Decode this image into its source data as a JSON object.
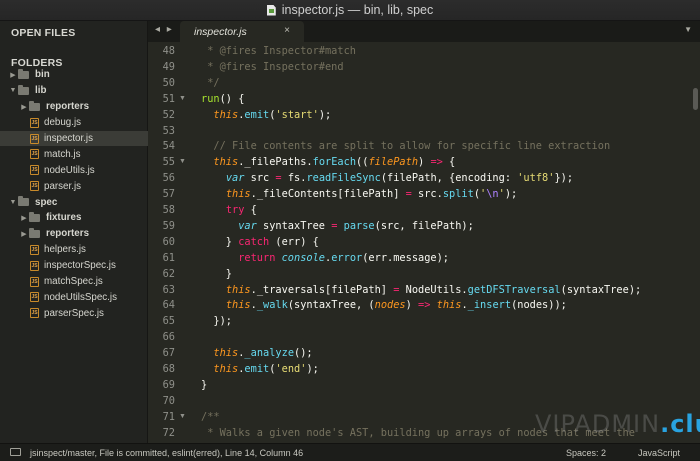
{
  "window": {
    "title": "inspector.js — bin, lib, spec"
  },
  "sidebar": {
    "open_files_heading": "OPEN FILES",
    "folders_heading": "FOLDERS",
    "tree": [
      {
        "label": "bin",
        "kind": "folder",
        "depth": 0,
        "expanded": false,
        "bold": true
      },
      {
        "label": "lib",
        "kind": "folder",
        "depth": 0,
        "expanded": true,
        "bold": true
      },
      {
        "label": "reporters",
        "kind": "folder",
        "depth": 1,
        "expanded": false,
        "bold": true
      },
      {
        "label": "debug.js",
        "kind": "file",
        "depth": 1
      },
      {
        "label": "inspector.js",
        "kind": "file",
        "depth": 1,
        "selected": true
      },
      {
        "label": "match.js",
        "kind": "file",
        "depth": 1
      },
      {
        "label": "nodeUtils.js",
        "kind": "file",
        "depth": 1
      },
      {
        "label": "parser.js",
        "kind": "file",
        "depth": 1
      },
      {
        "label": "spec",
        "kind": "folder",
        "depth": 0,
        "expanded": true,
        "bold": true
      },
      {
        "label": "fixtures",
        "kind": "folder",
        "depth": 1,
        "expanded": false,
        "bold": true
      },
      {
        "label": "reporters",
        "kind": "folder",
        "depth": 1,
        "expanded": false,
        "bold": true
      },
      {
        "label": "helpers.js",
        "kind": "file",
        "depth": 1
      },
      {
        "label": "inspectorSpec.js",
        "kind": "file",
        "depth": 1
      },
      {
        "label": "matchSpec.js",
        "kind": "file",
        "depth": 1
      },
      {
        "label": "nodeUtilsSpec.js",
        "kind": "file",
        "depth": 1
      },
      {
        "label": "parserSpec.js",
        "kind": "file",
        "depth": 1
      }
    ]
  },
  "tabs": {
    "nav_label": "◂ ▸",
    "active_tab": "inspector.js",
    "close_glyph": "×",
    "dropdown_glyph": "▼"
  },
  "editor": {
    "fold_glyph": "▼",
    "lines": [
      {
        "n": "48",
        "fold": false,
        "tokens": [
          [
            "c",
            " * @fires Inspector#match"
          ]
        ]
      },
      {
        "n": "49",
        "fold": false,
        "tokens": [
          [
            "c",
            " * @fires Inspector#end"
          ]
        ]
      },
      {
        "n": "50",
        "fold": false,
        "tokens": [
          [
            "c",
            " */"
          ]
        ]
      },
      {
        "n": "51",
        "fold": true,
        "tokens": [
          [
            "fn",
            "run"
          ],
          [
            "p",
            "() {"
          ]
        ]
      },
      {
        "n": "52",
        "fold": false,
        "tokens": [
          [
            "p",
            "  "
          ],
          [
            "i",
            "this"
          ],
          [
            "p",
            "."
          ],
          [
            "f",
            "emit"
          ],
          [
            "p",
            "("
          ],
          [
            "s",
            "'start'"
          ],
          [
            "p",
            ");"
          ]
        ]
      },
      {
        "n": "53",
        "fold": false,
        "tokens": []
      },
      {
        "n": "54",
        "fold": false,
        "tokens": [
          [
            "c",
            "  // File contents are split to allow for specific line extraction"
          ]
        ]
      },
      {
        "n": "55",
        "fold": true,
        "tokens": [
          [
            "p",
            "  "
          ],
          [
            "i",
            "this"
          ],
          [
            "p",
            "._filePaths."
          ],
          [
            "f",
            "forEach"
          ],
          [
            "p",
            "(("
          ],
          [
            "t",
            "filePath"
          ],
          [
            "p",
            ") "
          ],
          [
            "k",
            "=>"
          ],
          [
            "p",
            " {"
          ]
        ]
      },
      {
        "n": "56",
        "fold": false,
        "tokens": [
          [
            "p",
            "    "
          ],
          [
            "v",
            "var"
          ],
          [
            "p",
            " src "
          ],
          [
            "k",
            "="
          ],
          [
            "p",
            " fs."
          ],
          [
            "f",
            "readFileSync"
          ],
          [
            "p",
            "(filePath, {encoding: "
          ],
          [
            "s",
            "'utf8'"
          ],
          [
            "p",
            "});"
          ]
        ]
      },
      {
        "n": "57",
        "fold": false,
        "tokens": [
          [
            "p",
            "    "
          ],
          [
            "i",
            "this"
          ],
          [
            "p",
            "._fileContents[filePath] "
          ],
          [
            "k",
            "="
          ],
          [
            "p",
            " src."
          ],
          [
            "f",
            "split"
          ],
          [
            "p",
            "("
          ],
          [
            "s",
            "'"
          ],
          [
            "n",
            "\\n"
          ],
          [
            "s",
            "'"
          ],
          [
            "p",
            ");"
          ]
        ]
      },
      {
        "n": "58",
        "fold": false,
        "tokens": [
          [
            "p",
            "    "
          ],
          [
            "k",
            "try"
          ],
          [
            "p",
            " {"
          ]
        ]
      },
      {
        "n": "59",
        "fold": false,
        "tokens": [
          [
            "p",
            "      "
          ],
          [
            "v",
            "var"
          ],
          [
            "p",
            " syntaxTree "
          ],
          [
            "k",
            "="
          ],
          [
            "p",
            " "
          ],
          [
            "f",
            "parse"
          ],
          [
            "p",
            "(src, filePath);"
          ]
        ]
      },
      {
        "n": "60",
        "fold": false,
        "tokens": [
          [
            "p",
            "    } "
          ],
          [
            "k",
            "catch"
          ],
          [
            "p",
            " (err) {"
          ]
        ]
      },
      {
        "n": "61",
        "fold": false,
        "tokens": [
          [
            "p",
            "      "
          ],
          [
            "k",
            "return"
          ],
          [
            "p",
            " "
          ],
          [
            "v",
            "console"
          ],
          [
            "p",
            "."
          ],
          [
            "f",
            "error"
          ],
          [
            "p",
            "(err.message);"
          ]
        ]
      },
      {
        "n": "62",
        "fold": false,
        "tokens": [
          [
            "p",
            "    }"
          ]
        ]
      },
      {
        "n": "63",
        "fold": false,
        "tokens": [
          [
            "p",
            "    "
          ],
          [
            "i",
            "this"
          ],
          [
            "p",
            "._traversals[filePath] "
          ],
          [
            "k",
            "="
          ],
          [
            "p",
            " NodeUtils."
          ],
          [
            "f",
            "getDFSTraversal"
          ],
          [
            "p",
            "(syntaxTree);"
          ]
        ]
      },
      {
        "n": "64",
        "fold": false,
        "tokens": [
          [
            "p",
            "    "
          ],
          [
            "i",
            "this"
          ],
          [
            "p",
            "."
          ],
          [
            "f",
            "_walk"
          ],
          [
            "p",
            "(syntaxTree, ("
          ],
          [
            "t",
            "nodes"
          ],
          [
            "p",
            ") "
          ],
          [
            "k",
            "=>"
          ],
          [
            "p",
            " "
          ],
          [
            "i",
            "this"
          ],
          [
            "p",
            "."
          ],
          [
            "f",
            "_insert"
          ],
          [
            "p",
            "(nodes));"
          ]
        ]
      },
      {
        "n": "65",
        "fold": false,
        "tokens": [
          [
            "p",
            "  });"
          ]
        ]
      },
      {
        "n": "66",
        "fold": false,
        "tokens": []
      },
      {
        "n": "67",
        "fold": false,
        "tokens": [
          [
            "p",
            "  "
          ],
          [
            "i",
            "this"
          ],
          [
            "p",
            "."
          ],
          [
            "f",
            "_analyze"
          ],
          [
            "p",
            "();"
          ]
        ]
      },
      {
        "n": "68",
        "fold": false,
        "tokens": [
          [
            "p",
            "  "
          ],
          [
            "i",
            "this"
          ],
          [
            "p",
            "."
          ],
          [
            "f",
            "emit"
          ],
          [
            "p",
            "("
          ],
          [
            "s",
            "'end'"
          ],
          [
            "p",
            ");"
          ]
        ]
      },
      {
        "n": "69",
        "fold": false,
        "tokens": [
          [
            "p",
            "}"
          ]
        ]
      },
      {
        "n": "70",
        "fold": false,
        "tokens": []
      },
      {
        "n": "71",
        "fold": true,
        "tokens": [
          [
            "c",
            "/**"
          ]
        ]
      },
      {
        "n": "72",
        "fold": false,
        "tokens": [
          [
            "c",
            " * Walks a given node's AST, building up arrays of nodes that meet the"
          ]
        ]
      }
    ]
  },
  "watermark": {
    "text": "VIPADMIN",
    "accent": ".club"
  },
  "statusbar": {
    "text": "jsinspect/master, File is committed, eslint(erred), Line 14, Column 46",
    "spaces": "Spaces: 2",
    "syntax": "JavaScript"
  },
  "colors": {
    "background": "#272822",
    "sidebar": "#222320",
    "comment": "#75715e",
    "keyword": "#f92672",
    "string": "#e6db74",
    "function": "#66d9ef",
    "name": "#a6e22e",
    "parameter": "#fd971f"
  }
}
